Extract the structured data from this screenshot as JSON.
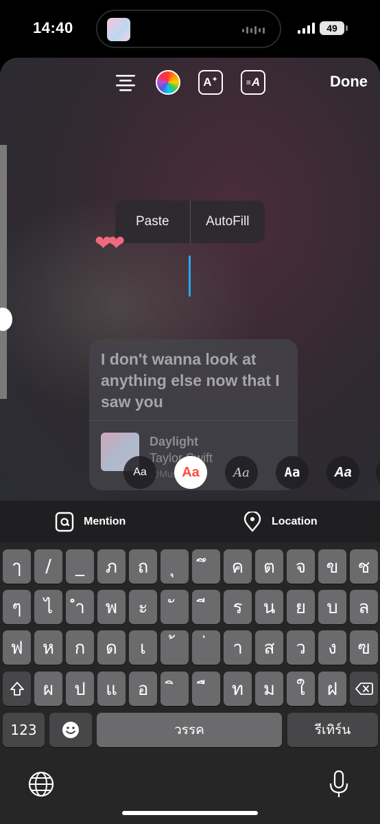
{
  "status_bar": {
    "time": "14:40",
    "battery": "49"
  },
  "toolbar": {
    "icons": [
      "align-icon",
      "color-wheel-icon",
      "text-effects-icon",
      "animate-text-icon"
    ],
    "effects_label": "A",
    "animate_label": "A",
    "done_label": "Done"
  },
  "context_menu": {
    "paste": "Paste",
    "autofill": "AutoFill"
  },
  "hearts": "❤❤",
  "lyric_card": {
    "lyrics": "I don't wanna look at anything else now that I saw you",
    "track_title": "Daylight",
    "track_artist": "Taylor Swift",
    "track_source": "@Mus"
  },
  "font_styles": [
    "Aa",
    "Aa",
    "Aa",
    "Aa",
    "Aa"
  ],
  "tag_bar": {
    "mention": "Mention",
    "location": "Location"
  },
  "keyboard": {
    "row1": [
      "ๅ",
      "/",
      "_",
      "ภ",
      "ถ",
      "ุ",
      "ึ",
      "ค",
      "ต",
      "จ",
      "ข",
      "ช"
    ],
    "row2": [
      "ๆ",
      "ไ",
      "ำ",
      "พ",
      "ะ",
      "ั",
      "ี",
      "ร",
      "น",
      "ย",
      "บ",
      "ล"
    ],
    "row3": [
      "ฟ",
      "ห",
      "ก",
      "ด",
      "เ",
      "้",
      "่",
      "า",
      "ส",
      "ว",
      "ง",
      "ฃ"
    ],
    "row4": [
      "ผ",
      "ป",
      "แ",
      "อ",
      "ิ",
      "ื",
      "ท",
      "ม",
      "ใ",
      "ฝ"
    ],
    "numbers": "123",
    "space": "วรรค",
    "return": "รีเทิร์น"
  },
  "colors": {
    "cursor": "#2aa6ff",
    "selected_font": "#ff4a3d",
    "hearts": "#f06a7f"
  }
}
